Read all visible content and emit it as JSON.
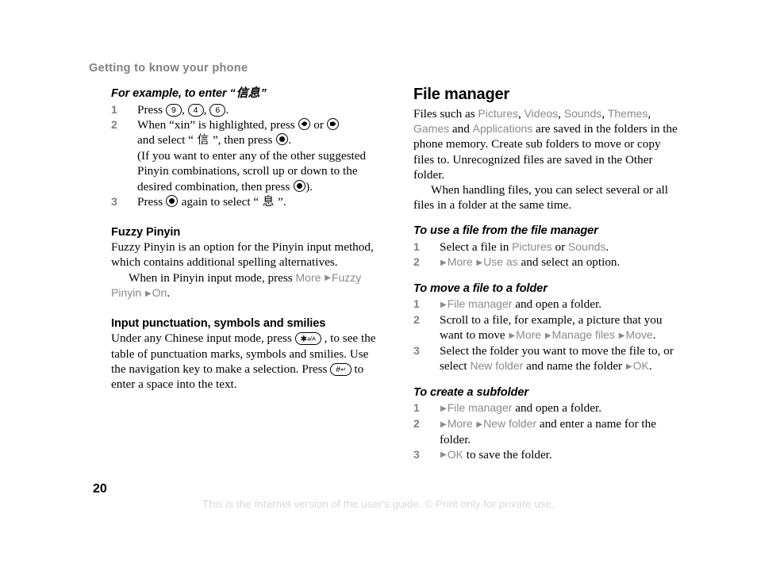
{
  "header": {
    "running_title": "Getting to know your phone"
  },
  "left_column": {
    "example": {
      "title_prefix": "For example, to enter “",
      "title_cjk": "信息",
      "title_suffix": "”",
      "steps": [
        {
          "num": "1",
          "text_before": "Press ",
          "keys": [
            "9",
            "4",
            "6"
          ],
          "text_after": "."
        },
        {
          "num": "2",
          "line1_a": "When “xin” is highlighted, press ",
          "line1_b": " or ",
          "line2_a": "and select “ ",
          "line2_cjk": "信",
          "line2_b": " ”, then press ",
          "line2_c": ".",
          "note_a": "(If you want to enter any of the other suggested Pinyin combinations, scroll up or down to the desired combination, then press ",
          "note_b": ")."
        },
        {
          "num": "3",
          "text_before": "Press ",
          "text_mid": " again to select “ ",
          "cjk": "息",
          "text_after": " ”."
        }
      ]
    },
    "fuzzy_pinyin": {
      "title": "Fuzzy Pinyin",
      "para1": "Fuzzy Pinyin is an option for the Pinyin input method, which contains additional spelling alternatives.",
      "para2_prefix": "When in Pinyin input mode, press ",
      "para2_ui1": "More",
      "para2_ui2": "Fuzzy Pinyin",
      "para2_ui3": "On",
      "para2_suffix": "."
    },
    "punctuation": {
      "title": "Input punctuation, symbols and smilies",
      "text_a": "Under any Chinese input mode, press ",
      "key_star_main": "✱",
      "key_star_small": "a/A",
      "text_b": " , to see the table of punctuation marks, symbols and smilies. Use the navigation key to make a selection. Press ",
      "key_hash_main": "#",
      "key_hash_small": "↵",
      "text_c": " to enter a space into the text."
    }
  },
  "right_column": {
    "file_manager": {
      "title": "File manager",
      "intro_a": "Files such as ",
      "intro_terms": [
        "Pictures",
        "Videos",
        "Sounds",
        "Themes",
        "Games",
        "Applications"
      ],
      "intro_and": " and ",
      "intro_b": " are saved in the folders in the phone memory. Create sub folders to move or copy files to. Unrecognized files are saved in the Other folder.",
      "intro_c": "When handling files, you can select several or all files in a folder at the same time."
    },
    "procedures": [
      {
        "title": "To use a file from the file manager",
        "steps": [
          {
            "num": "1",
            "seg_a": "Select a file in ",
            "ui1": "Pictures",
            "seg_b": " or ",
            "ui2": "Sounds",
            "seg_c": "."
          },
          {
            "num": "2",
            "ui1": "More",
            "ui2": "Use as",
            "seg_c": " and select an option."
          }
        ]
      },
      {
        "title": "To move a file to a folder",
        "steps": [
          {
            "num": "1",
            "ui1": "File manager",
            "seg_c": " and open a folder."
          },
          {
            "num": "2",
            "seg_a": "Scroll to a file, for example, a picture that you want to move ",
            "ui1": "More",
            "ui2": "Manage files",
            "ui3": "Move",
            "seg_c": "."
          },
          {
            "num": "3",
            "seg_a": "Select the folder you want to move the file to, or select ",
            "ui1": "New folder",
            "seg_b": " and name the folder ",
            "ui2": "OK",
            "seg_c": "."
          }
        ]
      },
      {
        "title": "To create a subfolder",
        "steps": [
          {
            "num": "1",
            "ui1": "File manager",
            "seg_c": " and open a folder."
          },
          {
            "num": "2",
            "ui1": "More",
            "ui2": "New folder",
            "seg_c": " and enter a name for the folder."
          },
          {
            "num": "3",
            "ui1": "OK",
            "seg_c": " to save the folder."
          }
        ]
      }
    ]
  },
  "footer": {
    "page_number": "20",
    "note": "This is the Internet version of the user's guide. © Print only for private use."
  }
}
